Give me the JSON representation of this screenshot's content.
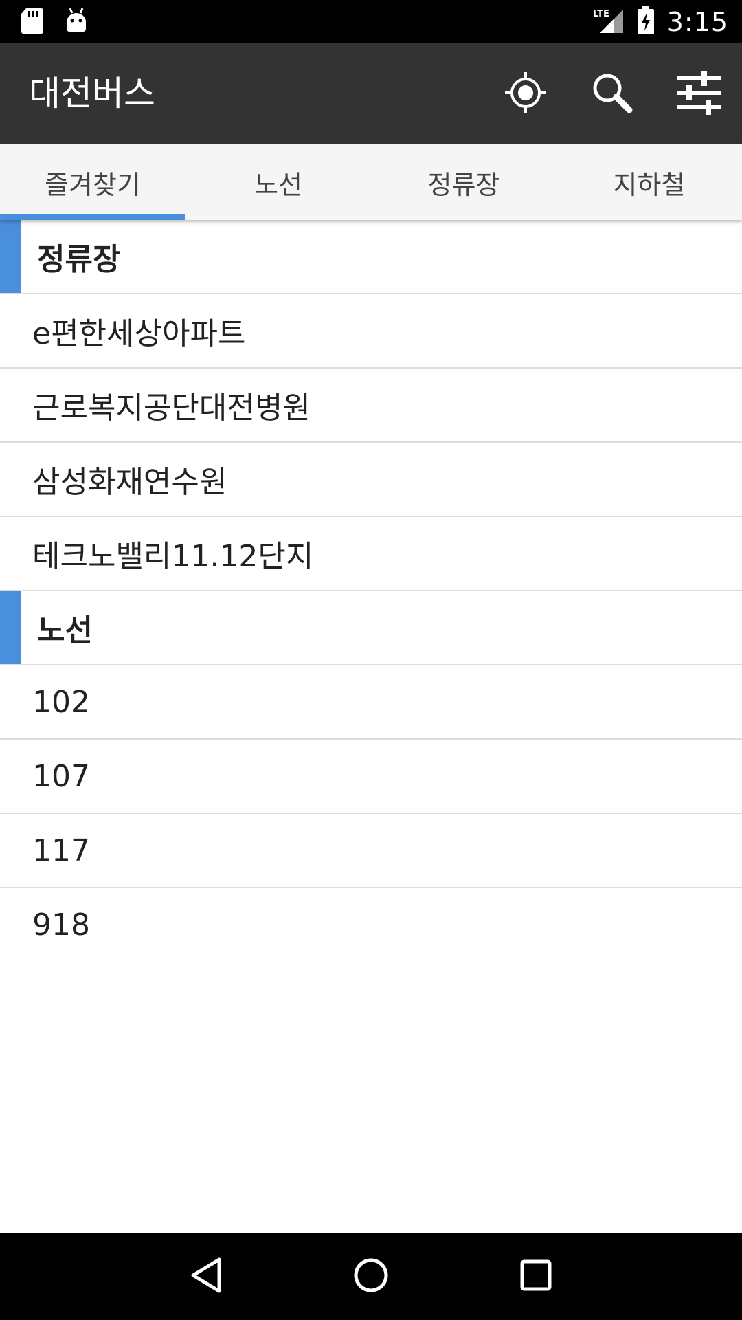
{
  "status_bar": {
    "network": "LTE",
    "time": "3:15",
    "left_icons": [
      "sd-card-icon",
      "android-icon"
    ],
    "right_icons": [
      "lte-signal-icon",
      "battery-charging-icon"
    ]
  },
  "app_bar": {
    "title": "대전버스",
    "actions": [
      "my-location-icon",
      "search-icon",
      "settings-sliders-icon"
    ],
    "background": "#333333"
  },
  "tabs": [
    {
      "label": "즐겨찾기",
      "active": true
    },
    {
      "label": "노선",
      "active": false
    },
    {
      "label": "정류장",
      "active": false
    },
    {
      "label": "지하철",
      "active": false
    }
  ],
  "accent_color": "#4a8fdb",
  "favorites": {
    "stops_section": {
      "title": "정류장",
      "items": [
        "e편한세상아파트",
        "근로복지공단대전병원",
        "삼성화재연수원",
        "테크노밸리11.12단지"
      ]
    },
    "routes_section": {
      "title": "노선",
      "items": [
        "102",
        "107",
        "117",
        "918"
      ]
    }
  },
  "nav_bar": {
    "buttons": [
      "back-icon",
      "home-icon",
      "recents-icon"
    ]
  }
}
